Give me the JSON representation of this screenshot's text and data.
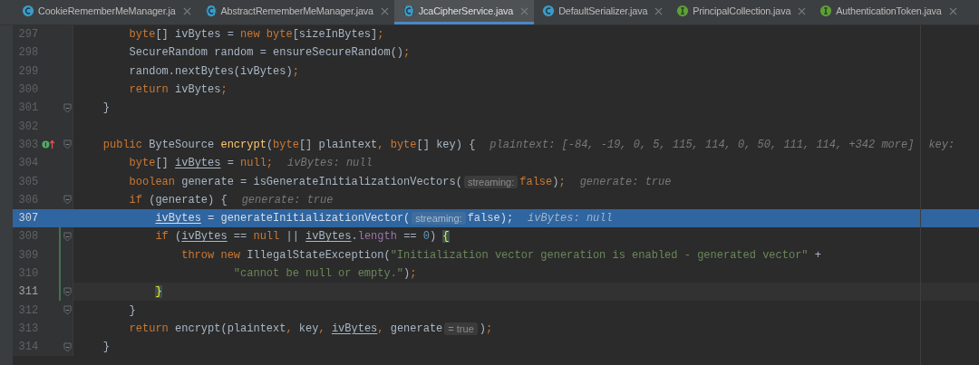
{
  "tabs": [
    {
      "label": "CookieRememberMeManager.ja",
      "kind": "class",
      "selected": false
    },
    {
      "label": "AbstractRememberMeManager.java",
      "kind": "abstract",
      "selected": false
    },
    {
      "label": "JcaCipherService.java",
      "kind": "abstract",
      "selected": true
    },
    {
      "label": "DefaultSerializer.java",
      "kind": "class",
      "selected": false
    },
    {
      "label": "PrincipalCollection.java",
      "kind": "interface",
      "selected": false
    },
    {
      "label": "AuthenticationToken.java",
      "kind": "interface",
      "selected": false
    }
  ],
  "lines": [
    {
      "number": "297",
      "fold": false,
      "changed": false,
      "segments": [
        {
          "kind": "code",
          "tokens": [
            {
              "kind": "kw",
              "text": "        byte"
            },
            {
              "kind": "plain",
              "text": "[] ivBytes = "
            },
            {
              "kind": "kw",
              "text": "new byte"
            },
            {
              "kind": "plain",
              "text": "[sizeInBytes]"
            },
            {
              "kind": "kw",
              "text": ";"
            }
          ]
        }
      ]
    },
    {
      "number": "298",
      "fold": false,
      "changed": false,
      "segments": [
        {
          "kind": "code",
          "tokens": [
            {
              "kind": "plain",
              "text": "        SecureRandom random = ensureSecureRandom()"
            },
            {
              "kind": "kw",
              "text": ";"
            }
          ]
        }
      ]
    },
    {
      "number": "299",
      "fold": false,
      "changed": false,
      "segments": [
        {
          "kind": "code",
          "tokens": [
            {
              "kind": "plain",
              "text": "        random.nextBytes(ivBytes)"
            },
            {
              "kind": "kw",
              "text": ";"
            }
          ]
        }
      ]
    },
    {
      "number": "300",
      "fold": false,
      "changed": false,
      "segments": [
        {
          "kind": "code",
          "tokens": [
            {
              "kind": "kw",
              "text": "        return "
            },
            {
              "kind": "plain",
              "text": "ivBytes"
            },
            {
              "kind": "kw",
              "text": ";"
            }
          ]
        }
      ]
    },
    {
      "number": "301",
      "fold": true,
      "changed": false,
      "segments": [
        {
          "kind": "code",
          "tokens": [
            {
              "kind": "plain",
              "text": "    }"
            }
          ]
        }
      ]
    },
    {
      "number": "302",
      "fold": false,
      "changed": false
    },
    {
      "number": "303",
      "fold": true,
      "changed": false,
      "implements": true,
      "segments": [
        {
          "kind": "code",
          "tokens": [
            {
              "kind": "kw",
              "text": "    public "
            },
            {
              "kind": "plain",
              "text": "ByteSource "
            },
            {
              "kind": "decl",
              "text": "encrypt"
            },
            {
              "kind": "plain",
              "text": "("
            },
            {
              "kind": "kw",
              "text": "byte"
            },
            {
              "kind": "plain",
              "text": "[] plaintext"
            },
            {
              "kind": "kw",
              "text": ", byte"
            },
            {
              "kind": "plain",
              "text": "[] key) {"
            }
          ]
        },
        {
          "kind": "hint",
          "text": "plaintext: [-84, -19, 0, 5, 115, 114, 0, 50, 111, 114, +342 more]"
        },
        {
          "kind": "hint",
          "text": "key:"
        }
      ]
    },
    {
      "number": "304",
      "fold": false,
      "changed": false,
      "segments": [
        {
          "kind": "code",
          "tokens": [
            {
              "kind": "kw",
              "text": "        byte"
            },
            {
              "kind": "plain",
              "text": "[] "
            },
            {
              "kind": "var",
              "text": "ivBytes"
            },
            {
              "kind": "plain",
              "text": " = "
            },
            {
              "kind": "kw",
              "text": "null;"
            }
          ]
        },
        {
          "kind": "hint",
          "text": "ivBytes: null"
        }
      ]
    },
    {
      "number": "305",
      "fold": false,
      "changed": false,
      "segments": [
        {
          "kind": "code",
          "tokens": [
            {
              "kind": "kw",
              "text": "        boolean "
            },
            {
              "kind": "plain",
              "text": "generate = isGenerateInitializationVectors("
            }
          ]
        },
        {
          "kind": "inlay",
          "text": "streaming:"
        },
        {
          "kind": "code",
          "tokens": [
            {
              "kind": "kw",
              "text": "false"
            },
            {
              "kind": "plain",
              "text": ")"
            },
            {
              "kind": "kw",
              "text": ";"
            }
          ]
        },
        {
          "kind": "hint",
          "text": "generate: true"
        }
      ]
    },
    {
      "number": "306",
      "fold": true,
      "changed": false,
      "segments": [
        {
          "kind": "code",
          "tokens": [
            {
              "kind": "kw",
              "text": "        if "
            },
            {
              "kind": "plain",
              "text": "(generate) {"
            }
          ]
        },
        {
          "kind": "hint",
          "text": "generate: true"
        }
      ]
    },
    {
      "number": "307",
      "fold": false,
      "changed": false,
      "execution_point": true,
      "segments": [
        {
          "kind": "code",
          "tokens": [
            {
              "kind": "var",
              "text": "            ivBytes"
            },
            {
              "kind": "plain",
              "text": " = generateInitializationVector("
            }
          ]
        },
        {
          "kind": "inlay",
          "text": "streaming:"
        },
        {
          "kind": "code",
          "tokens": [
            {
              "kind": "kw",
              "text": "false"
            },
            {
              "kind": "plain",
              "text": ")"
            },
            {
              "kind": "kw",
              "text": ";"
            }
          ]
        },
        {
          "kind": "hint",
          "text": "ivBytes: null"
        }
      ]
    },
    {
      "number": "308",
      "fold": true,
      "changed": true,
      "segments": [
        {
          "kind": "code",
          "tokens": [
            {
              "kind": "kw",
              "text": "            if "
            },
            {
              "kind": "plain",
              "text": "("
            },
            {
              "kind": "var",
              "text": "ivBytes"
            },
            {
              "kind": "plain",
              "text": " == "
            },
            {
              "kind": "kw",
              "text": "null "
            },
            {
              "kind": "plain",
              "text": "|| "
            },
            {
              "kind": "var",
              "text": "ivBytes"
            },
            {
              "kind": "plain",
              "text": "."
            },
            {
              "kind": "field",
              "text": "length"
            },
            {
              "kind": "plain",
              "text": " == "
            },
            {
              "kind": "num",
              "text": "0"
            },
            {
              "kind": "plain",
              "text": ") "
            },
            {
              "kind": "brace",
              "text": "{"
            }
          ]
        }
      ]
    },
    {
      "number": "309",
      "fold": false,
      "changed": true,
      "segments": [
        {
          "kind": "code",
          "tokens": [
            {
              "kind": "kw",
              "text": "                throw new "
            },
            {
              "kind": "plain",
              "text": "IllegalStateException("
            },
            {
              "kind": "str",
              "text": "\"Initialization vector generation is enabled - generated vector\""
            },
            {
              "kind": "plain",
              "text": " +"
            }
          ]
        }
      ]
    },
    {
      "number": "310",
      "fold": false,
      "changed": true,
      "segments": [
        {
          "kind": "code",
          "tokens": [
            {
              "kind": "str",
              "text": "                        \"cannot be null or empty.\""
            },
            {
              "kind": "plain",
              "text": ")"
            },
            {
              "kind": "kw",
              "text": ";"
            }
          ]
        }
      ]
    },
    {
      "number": "311",
      "fold": true,
      "changed": true,
      "caret_line": true,
      "segments": [
        {
          "kind": "code",
          "tokens": [
            {
              "kind": "brace",
              "text": "            }"
            }
          ]
        }
      ]
    },
    {
      "number": "312",
      "fold": true,
      "changed": false,
      "segments": [
        {
          "kind": "code",
          "tokens": [
            {
              "kind": "plain",
              "text": "        }"
            }
          ]
        }
      ]
    },
    {
      "number": "313",
      "fold": false,
      "changed": false,
      "segments": [
        {
          "kind": "code",
          "tokens": [
            {
              "kind": "kw",
              "text": "        return "
            },
            {
              "kind": "plain",
              "text": "encrypt(plaintext"
            },
            {
              "kind": "kw",
              "text": ", "
            },
            {
              "kind": "plain",
              "text": "key"
            },
            {
              "kind": "kw",
              "text": ", "
            },
            {
              "kind": "var",
              "text": "ivBytes"
            },
            {
              "kind": "kw",
              "text": ", "
            },
            {
              "kind": "plain",
              "text": "generate"
            }
          ]
        },
        {
          "kind": "inlay",
          "text": "= true"
        },
        {
          "kind": "code",
          "tokens": [
            {
              "kind": "plain",
              "text": ")"
            },
            {
              "kind": "kw",
              "text": ";"
            }
          ]
        }
      ]
    },
    {
      "number": "314",
      "fold": true,
      "changed": false,
      "segments": [
        {
          "kind": "code",
          "tokens": [
            {
              "kind": "plain",
              "text": "    }"
            }
          ]
        }
      ]
    }
  ]
}
